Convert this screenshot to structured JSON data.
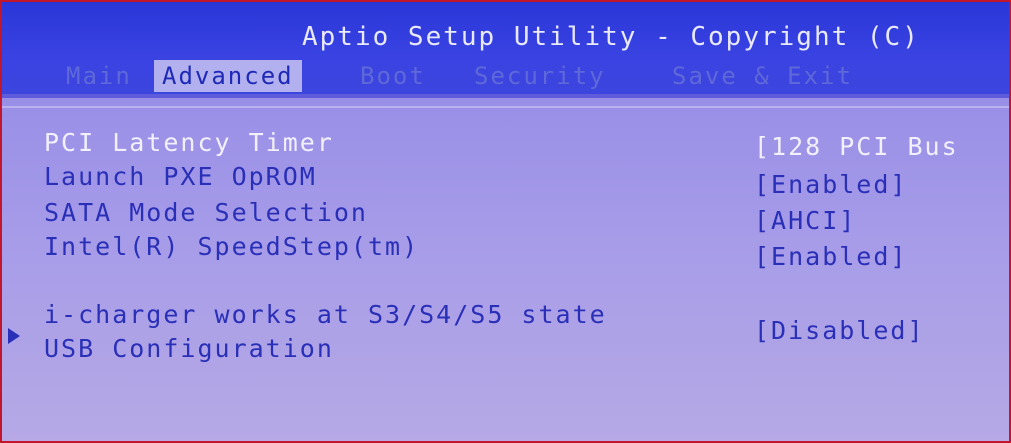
{
  "header": {
    "title": "Aptio Setup Utility - Copyright (C)"
  },
  "tabs": [
    {
      "label": "Main",
      "active": false
    },
    {
      "label": "Advanced",
      "active": true
    },
    {
      "label": "Boot",
      "active": false
    },
    {
      "label": "Security",
      "active": false
    },
    {
      "label": "Save & Exit",
      "active": false
    }
  ],
  "settings": [
    {
      "label": "PCI Latency Timer",
      "value": "[128 PCI Bus",
      "selected": true
    },
    {
      "label": "Launch PXE OpROM",
      "value": "[Enabled]",
      "selected": false
    },
    {
      "label": "SATA Mode Selection",
      "value": "[AHCI]",
      "selected": false
    },
    {
      "label": "Intel(R) SpeedStep(tm)",
      "value": "[Enabled]",
      "selected": false
    },
    {
      "label": "i-charger works at S3/S4/S5 state",
      "value": "[Disabled]",
      "selected": false
    },
    {
      "label": "USB Configuration",
      "submenu": true,
      "selected": false
    }
  ],
  "icons": {
    "submenu": "submenu-arrow-icon"
  },
  "colors": {
    "header_bg": "#2a36d8",
    "panel_bg": "#a79ce8",
    "active_tab_bg": "#b2b0ee",
    "text": "#2a2fb8",
    "selected_text": "#f2f0ff"
  }
}
